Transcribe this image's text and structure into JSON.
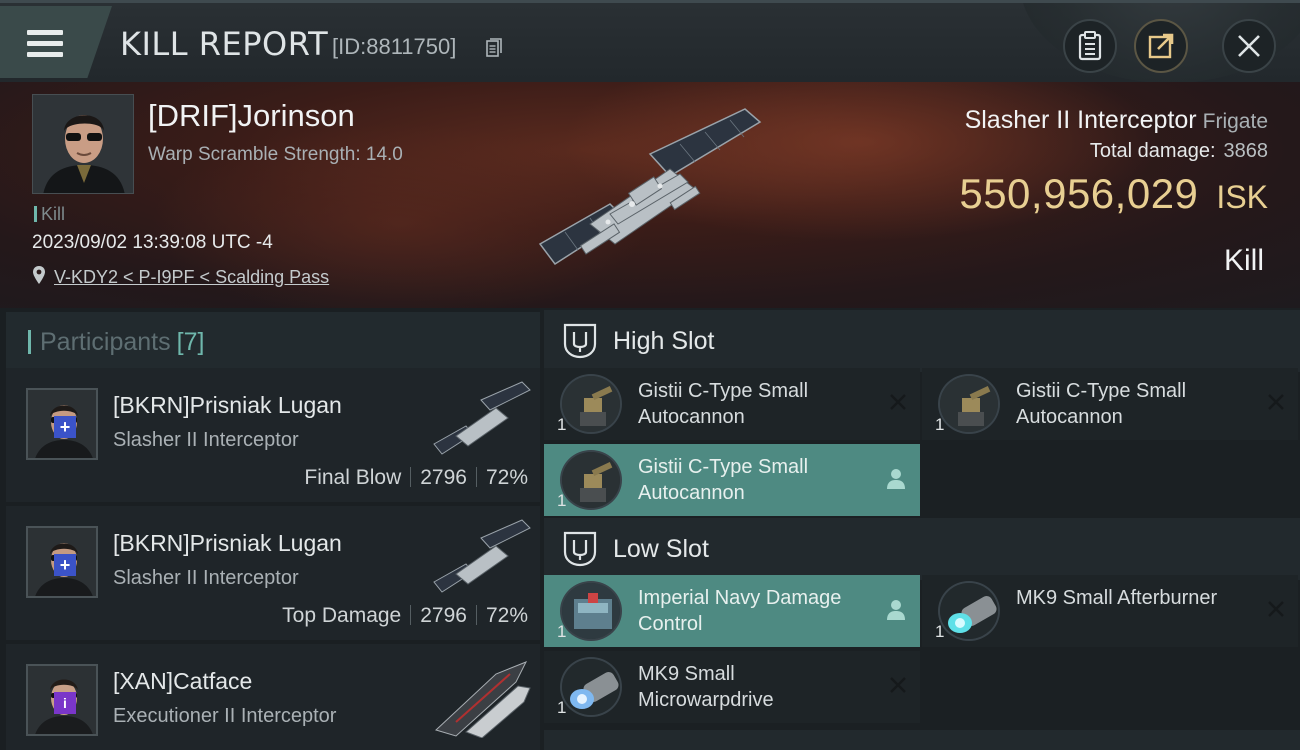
{
  "header": {
    "title": "KILL REPORT",
    "report_id": "[ID:8811750]"
  },
  "victim": {
    "name": "[DRIF]Jorinson",
    "scram_text": "Warp Scramble Strength: 14.0",
    "tag": "Kill",
    "time": "2023/09/02 13:39:08 UTC -4",
    "location": "V-KDY2 < P-I9PF < Scalding Pass",
    "ship": "Slasher II Interceptor",
    "ship_class": "Frigate",
    "total_damage_label": "Total damage:",
    "total_damage": "3868",
    "isk_value": "550,956,029",
    "isk_unit": "ISK",
    "result": "Kill"
  },
  "participants": {
    "label": "Participants",
    "count": "[7]",
    "items": [
      {
        "name": "[BKRN]Prisniak Lugan",
        "ship": "Slasher II Interceptor",
        "role": "Final Blow",
        "damage": "2796",
        "percent": "72%",
        "badge": "+"
      },
      {
        "name": "[BKRN]Prisniak Lugan",
        "ship": "Slasher II Interceptor",
        "role": "Top Damage",
        "damage": "2796",
        "percent": "72%",
        "badge": "+"
      },
      {
        "name": "[XAN]Catface",
        "ship": "Executioner II Interceptor",
        "role": "",
        "damage": "",
        "percent": "",
        "badge": "i"
      }
    ]
  },
  "fitting": {
    "high_slot": {
      "label": "High Slot",
      "modules": [
        {
          "name": "Gistii C-Type Small Autocannon",
          "qty": "1",
          "state": "destroyed"
        },
        {
          "name": "Gistii C-Type Small Autocannon",
          "qty": "1",
          "state": "destroyed"
        },
        {
          "name": "Gistii C-Type Small Autocannon",
          "qty": "1",
          "state": "dropped"
        }
      ]
    },
    "low_slot": {
      "label": "Low Slot",
      "modules": [
        {
          "name": "Imperial Navy Damage Control",
          "qty": "1",
          "state": "dropped"
        },
        {
          "name": "MK9 Small Afterburner",
          "qty": "1",
          "state": "destroyed"
        },
        {
          "name": "MK9 Small Microwarpdrive",
          "qty": "1",
          "state": "destroyed"
        }
      ]
    }
  },
  "icons": {
    "menu": "hamburger-icon",
    "copy": "copy-icon",
    "doc": "clipboard-icon",
    "share": "share-icon",
    "close": "close-icon",
    "pin": "location-pin-icon",
    "slot": "slot-tuning-fork-icon",
    "destroyed": "x-mark-icon",
    "dropped": "person-icon"
  },
  "colors": {
    "accent": "#6fb7ac",
    "isk": "#e8cf92",
    "dropped_bg": "#4e8a82"
  }
}
